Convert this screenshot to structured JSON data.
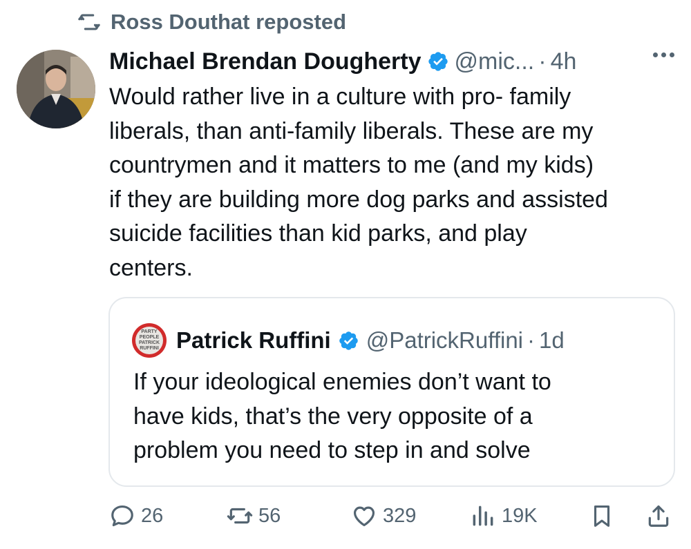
{
  "repost": {
    "icon": "repost-icon",
    "text": "Ross Douthat reposted"
  },
  "tweet": {
    "avatar_icon": "avatar",
    "author_name": "Michael Brendan Dougherty",
    "verified_icon": "verified-badge-icon",
    "handle": "@mic...",
    "separator": "·",
    "time": "4h",
    "more_icon": "more-options-icon",
    "text": "Would rather live in a culture with pro- family\nliberals, than anti-family liberals. These are my\ncountrymen and it matters to me (and my kids)\nif they are building more dog parks and assisted\nsuicide facilities than kid parks, and play\ncenters."
  },
  "quote": {
    "avatar_text": [
      "PARTY",
      "PEOPLE",
      "PATRICK",
      "RUFFINI"
    ],
    "author_name": "Patrick Ruffini",
    "verified_icon": "verified-badge-icon",
    "handle": "@PatrickRuffini",
    "separator": "·",
    "time": "1d",
    "text": "If your ideological enemies don’t want to\nhave kids, that’s the very opposite of a\nproblem you need to step in and solve"
  },
  "actions": {
    "replies": "26",
    "reposts": "56",
    "likes": "329",
    "views": "19K"
  },
  "colors": {
    "text": "#0f1419",
    "secondary": "#536471",
    "verified": "#1d9bf0",
    "border": "#e4e8ec"
  }
}
